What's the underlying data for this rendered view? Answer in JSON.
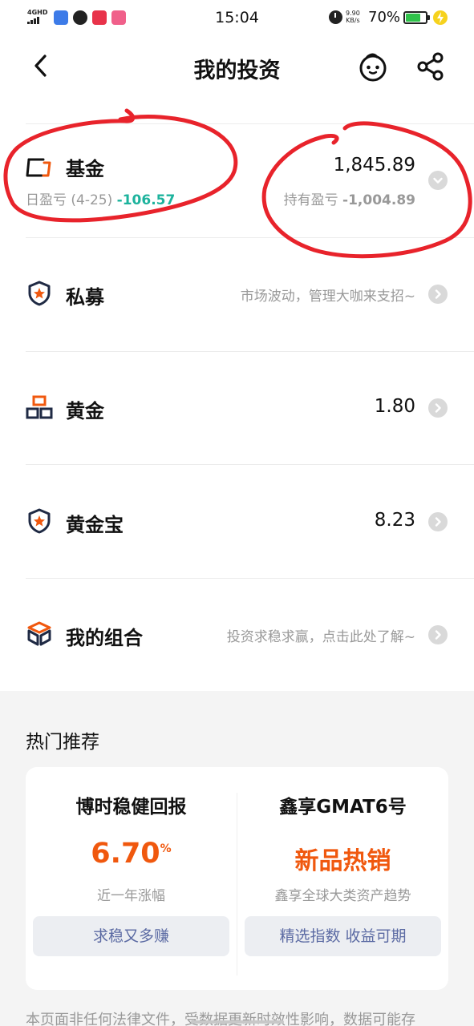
{
  "status_bar": {
    "network": "4GHD",
    "time": "15:04",
    "speed_value": "9.90",
    "speed_unit": "KB/s",
    "battery": "70%",
    "battery_level": 0.7
  },
  "header": {
    "title": "我的投资"
  },
  "fund": {
    "label": "基金",
    "amount": "1,845.89",
    "daily_prefix": "日盈亏 (4-25) ",
    "daily_value": "-106.57",
    "hold_prefix": "持有盈亏 ",
    "hold_value": "-1,004.89"
  },
  "rows": [
    {
      "label": "私募",
      "hint": "市场波动，管理大咖来支招~"
    },
    {
      "label": "黄金",
      "value": "1.80"
    },
    {
      "label": "黄金宝",
      "value": "8.23"
    },
    {
      "label": "我的组合",
      "hint": "投资求稳求赢，点击此处了解~"
    }
  ],
  "hot": {
    "title": "热门推荐",
    "left": {
      "name": "博时稳健回报",
      "rate": "6.70",
      "rate_unit": "%",
      "desc": "近一年涨幅",
      "button": "求稳又多赚"
    },
    "right": {
      "name": "鑫享GMAT6号",
      "tag": "新品热销",
      "desc": "鑫享全球大类资产趋势",
      "button": "精选指数 收益可期"
    }
  },
  "disclaimer": "本页面非任何法律文件，受数据更新时效性影响，数据可能存",
  "colors": {
    "negative": "#1db39d",
    "accent": "#f0580e",
    "annotation": "#e8232b",
    "button_text": "#5b6aa3"
  }
}
